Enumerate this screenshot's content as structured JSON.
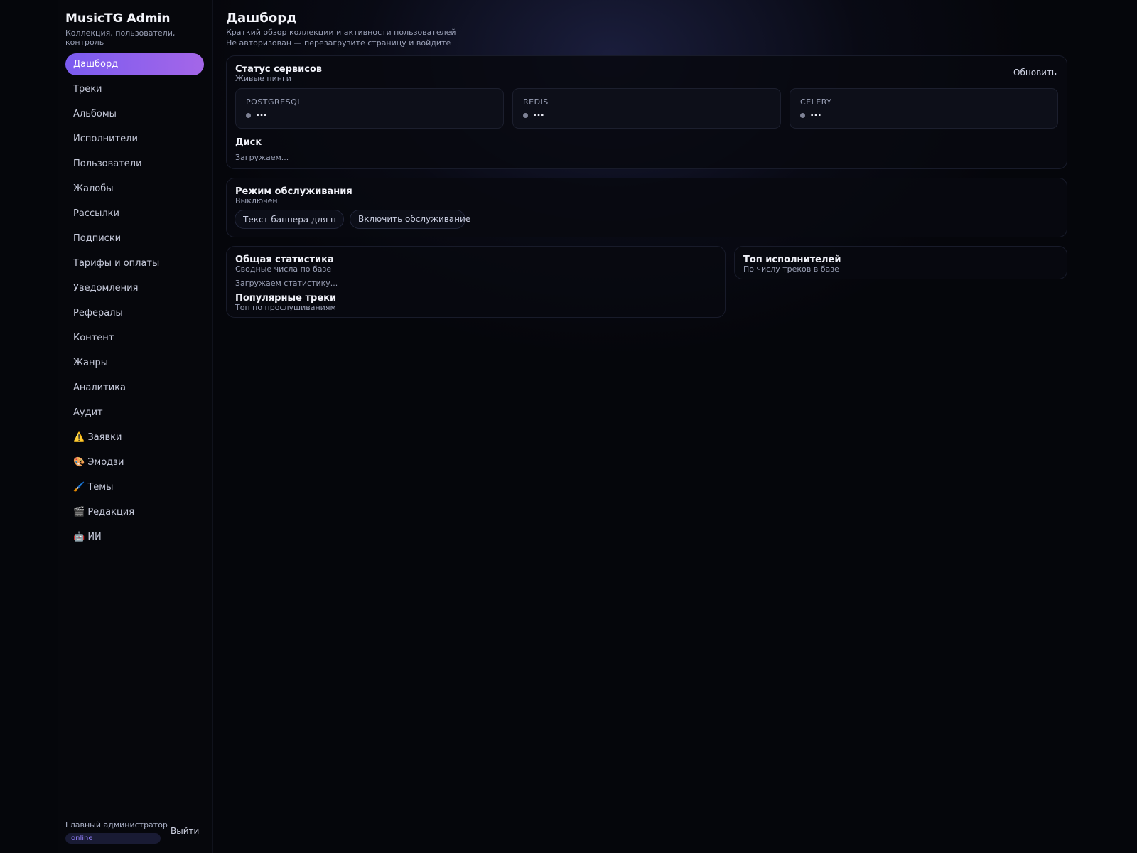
{
  "brand": {
    "title": "MusicTG Admin",
    "subtitle": "Коллекция, пользователи, контроль"
  },
  "nav": {
    "items": [
      {
        "label": "Дашборд",
        "active": true
      },
      {
        "label": "Треки"
      },
      {
        "label": "Альбомы"
      },
      {
        "label": "Исполнители"
      },
      {
        "label": "Пользователи"
      },
      {
        "label": "Жалобы"
      },
      {
        "label": "Рассылки"
      },
      {
        "label": "Подписки"
      },
      {
        "label": "Тарифы и оплаты"
      },
      {
        "label": "Уведомления"
      },
      {
        "label": "Рефералы"
      },
      {
        "label": "Контент"
      },
      {
        "label": "Жанры"
      },
      {
        "label": "Аналитика"
      },
      {
        "label": "Аудит"
      },
      {
        "label": "⚠️ Заявки"
      },
      {
        "label": "🎨 Эмодзи"
      },
      {
        "label": "🖌️ Темы"
      },
      {
        "label": "🎬 Редакция"
      },
      {
        "label": "🤖 ИИ"
      }
    ]
  },
  "footer": {
    "admin_role": "Главный администратор",
    "status": "online",
    "logout_label": "Выйти"
  },
  "header": {
    "title": "Дашборд",
    "subtitle": "Краткий обзор коллекции и активности пользователей",
    "auth_notice": "Не авторизован — перезагрузите страницу и войдите"
  },
  "services": {
    "title": "Статус сервисов",
    "subtitle": "Живые пинги",
    "refresh_label": "Обновить",
    "items": [
      {
        "name": "POSTGRESQL",
        "value": "..."
      },
      {
        "name": "REDIS",
        "value": "..."
      },
      {
        "name": "CELERY",
        "value": "..."
      }
    ],
    "disk_title": "Диск",
    "disk_status": "Загружаем..."
  },
  "maintenance": {
    "title": "Режим обслуживания",
    "status": "Выключен",
    "banner_placeholder": "Текст баннера для пользователей",
    "enable_label": "Включить обслуживание"
  },
  "stats": {
    "title": "Общая статистика",
    "subtitle": "Сводные числа по базе",
    "loading": "Загружаем статистику...",
    "popular_title": "Популярные треки",
    "popular_subtitle": "Топ по прослушиваниям"
  },
  "top_artists": {
    "title": "Топ исполнителей",
    "subtitle": "По числу треков в базе"
  },
  "colors": {
    "accent_start": "#7b5cf0",
    "accent_end": "#a466e8",
    "background": "#05060b"
  }
}
